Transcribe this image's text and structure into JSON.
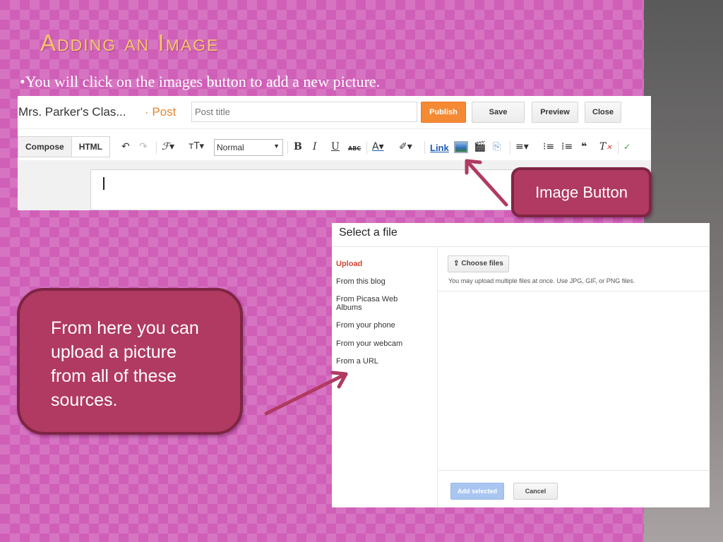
{
  "slide": {
    "title": "Adding an Image",
    "bullet_symbol": "•",
    "bullet_text": "You will click on the images button to add a new picture."
  },
  "editor": {
    "blog_name": "Mrs. Parker's Clas...",
    "crumb": "· Post",
    "post_title_placeholder": "Post title",
    "publish_label": "Publish",
    "save_label": "Save",
    "preview_label": "Preview",
    "close_label": "Close",
    "compose_label": "Compose",
    "html_label": "HTML",
    "font_size_value": "Normal",
    "link_label": "Link",
    "publish_color": "#f58a34"
  },
  "callouts": {
    "image_button": "Image Button",
    "sources": "From here you can upload a picture from all of these sources."
  },
  "dialog": {
    "title": "Select a file",
    "sources": [
      {
        "label": "Upload",
        "active": true
      },
      {
        "label": "From this blog"
      },
      {
        "label": "From Picasa Web Albums"
      },
      {
        "label": "From your phone"
      },
      {
        "label": "From your webcam"
      },
      {
        "label": "From a URL"
      }
    ],
    "choose_files_label": "Choose files",
    "hint": "You may upload multiple files at once. Use JPG, GIF, or PNG files.",
    "add_selected_label": "Add selected",
    "cancel_label": "Cancel"
  },
  "colors": {
    "background": "#d05fb8",
    "title": "#f7c56b",
    "callout_fill": "#b03a61",
    "callout_border": "#7e2544"
  },
  "icons": [
    "undo-icon",
    "redo-icon",
    "font-family-icon",
    "font-size-icon",
    "bold-icon",
    "italic-icon",
    "underline-icon",
    "strikethrough-icon",
    "text-color-icon",
    "highlight-icon",
    "insert-image-icon",
    "insert-video-icon",
    "jump-break-icon",
    "align-icon",
    "numbered-list-icon",
    "bullet-list-icon",
    "quote-icon",
    "clear-formatting-icon",
    "spellcheck-icon",
    "upload-icon"
  ]
}
